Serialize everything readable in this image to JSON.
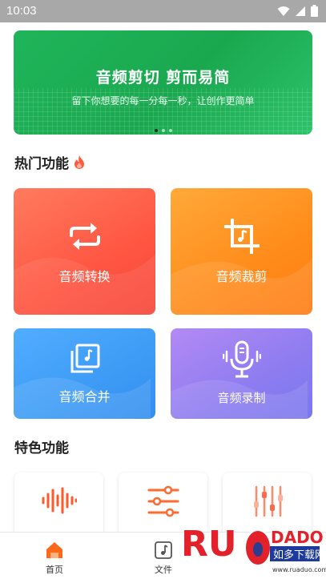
{
  "status_bar": {
    "time": "10:03"
  },
  "banner": {
    "title": "音频剪切 剪而易简",
    "subtitle": "留下你想要的每一分每一秒，让创作更简单",
    "page_count": 3,
    "active_page": 1,
    "color": "#1fb056"
  },
  "hot_section": {
    "title": "热门功能",
    "cards": [
      {
        "label": "音频转换",
        "icon": "repeat-arrows-icon",
        "color": "#ff5e4a"
      },
      {
        "label": "音频裁剪",
        "icon": "crop-music-icon",
        "color": "#ff8c1a"
      },
      {
        "label": "音频合并",
        "icon": "music-stack-icon",
        "color": "#3d9bf5"
      },
      {
        "label": "音频录制",
        "icon": "microphone-icon",
        "color": "#8a7cf0"
      }
    ]
  },
  "special_section": {
    "title": "特色功能",
    "cards": [
      {
        "icon": "waveform-icon"
      },
      {
        "icon": "sliders-icon"
      },
      {
        "icon": "equalizer-icon"
      }
    ]
  },
  "tab_bar": {
    "tabs": [
      {
        "label": "首页",
        "icon": "home-icon",
        "active": true
      },
      {
        "label": "文件",
        "icon": "music-file-icon",
        "active": false
      }
    ]
  },
  "watermark": {
    "brand": "RUANDADO",
    "tagline": "如多下载网",
    "url": "www.ruaduo.com"
  }
}
